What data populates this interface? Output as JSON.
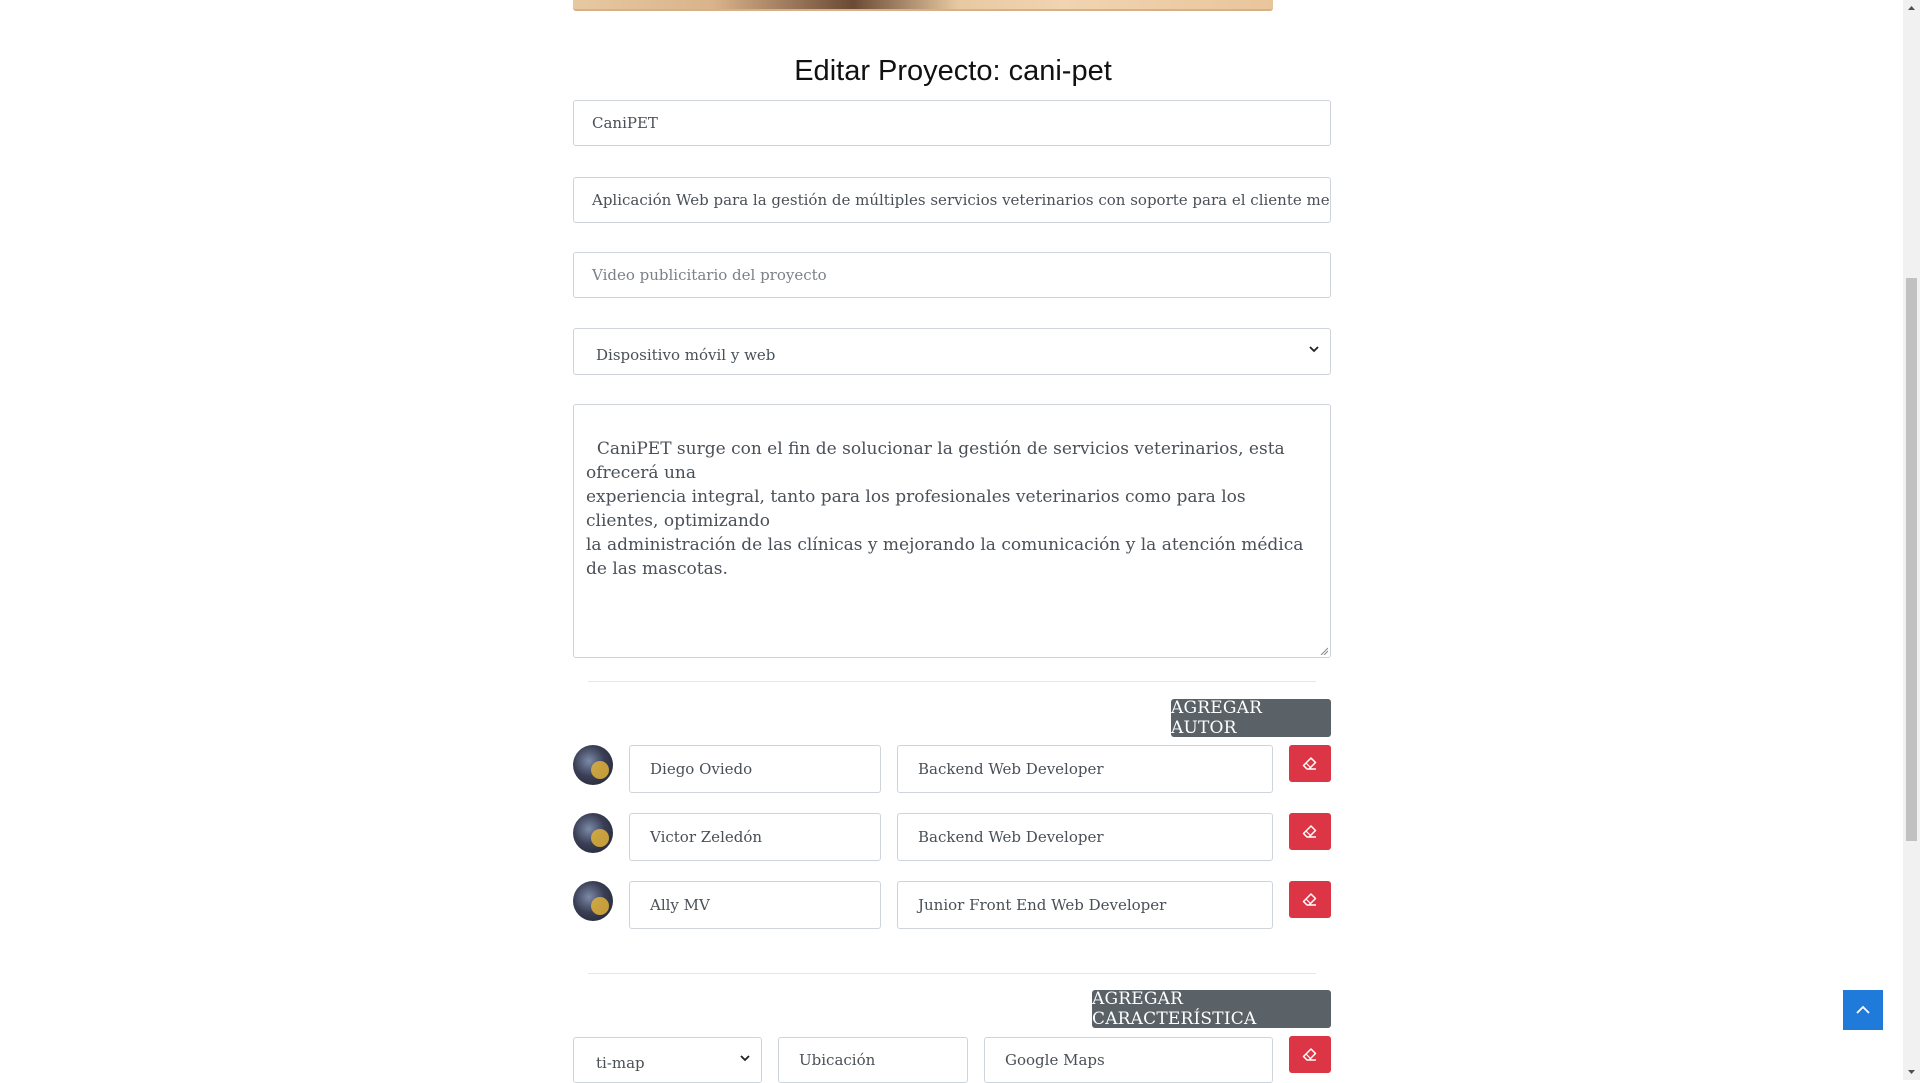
{
  "page": {
    "title": "Editar Proyecto: cani-pet"
  },
  "form": {
    "name_value": "CaniPET",
    "summary_value": "Aplicación Web para la gestión de múltiples servicios veterinarios con soporte para el cliente mediante una apl",
    "video_placeholder": "Video publicitario del proyecto",
    "platform_selected": "Dispositivo móvil y web",
    "description_value": "CaniPET surge con el fin de solucionar la gestión de servicios veterinarios, esta ofrecerá una\nexperiencia integral, tanto para los profesionales veterinarios como para los clientes, optimizando\nla administración de las clínicas y mejorando la comunicación y la atención médica\nde las mascotas."
  },
  "authors": {
    "add_label": "AGREGAR AUTOR",
    "items": [
      {
        "name": "Diego Oviedo",
        "role": "Backend Web Developer"
      },
      {
        "name": "Victor Zeledón",
        "role": "Backend Web Developer"
      },
      {
        "name": "Ally MV",
        "role": "Junior Front End Web Developer"
      }
    ]
  },
  "features": {
    "add_label": "AGREGAR CARACTERÍSTICA",
    "items": [
      {
        "icon_selected": "ti-map",
        "title": "Ubicación",
        "description": "Google Maps"
      }
    ]
  },
  "icons": {
    "delete": "eraser-icon",
    "back_to_top": "chevron-up-icon",
    "select": "chevron-down-icon"
  },
  "colors": {
    "danger": "#dc3545",
    "secondary": "#5a6268",
    "primary": "#1f7ad9"
  }
}
